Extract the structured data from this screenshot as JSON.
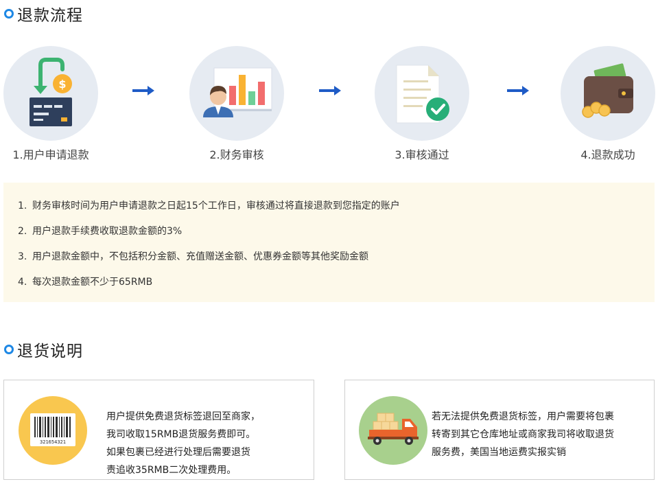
{
  "refund_section": {
    "title": "退款流程",
    "steps": [
      {
        "label": "1.用户申请退款",
        "icon": "refund-card-icon"
      },
      {
        "label": "2.财务审核",
        "icon": "finance-review-icon"
      },
      {
        "label": "3.审核通过",
        "icon": "approved-document-icon"
      },
      {
        "label": "4.退款成功",
        "icon": "wallet-icon"
      }
    ],
    "notes": [
      {
        "num": "1.",
        "text": "财务审核时间为用户申请退款之日起15个工作日，审核通过将直接退款到您指定的账户"
      },
      {
        "num": "2.",
        "text": "用户退款手续费收取退款金额的3%"
      },
      {
        "num": "3.",
        "text": "用户退款金额中，不包括积分金额、充值赠送金额、优惠券金额等其他奖励金额"
      },
      {
        "num": "4.",
        "text": "每次退款金额不少于65RMB"
      }
    ]
  },
  "return_section": {
    "title": "退货说明",
    "cards": [
      {
        "icon": "barcode-icon",
        "barcode_number": "321654321",
        "lines": [
          "用户提供免费退货标签退回至商家，",
          "我司收取15RMB退货服务费即可。",
          "如果包裹已经进行处理后需要退货",
          "责追收35RMB二次处理费用。"
        ]
      },
      {
        "icon": "delivery-truck-icon",
        "lines": [
          "若无法提供免费退货标签，用户需要将包裹",
          "转寄到其它仓库地址或商家我司将收取退货",
          "服务费，美国当地运费实报实销"
        ]
      }
    ]
  },
  "colors": {
    "accent_blue": "#1e88e5",
    "step_circle": "#e6ebf2",
    "notes_background": "#fdf9ea",
    "barcode_circle": "#f9c74f",
    "truck_circle": "#a8d08d"
  }
}
